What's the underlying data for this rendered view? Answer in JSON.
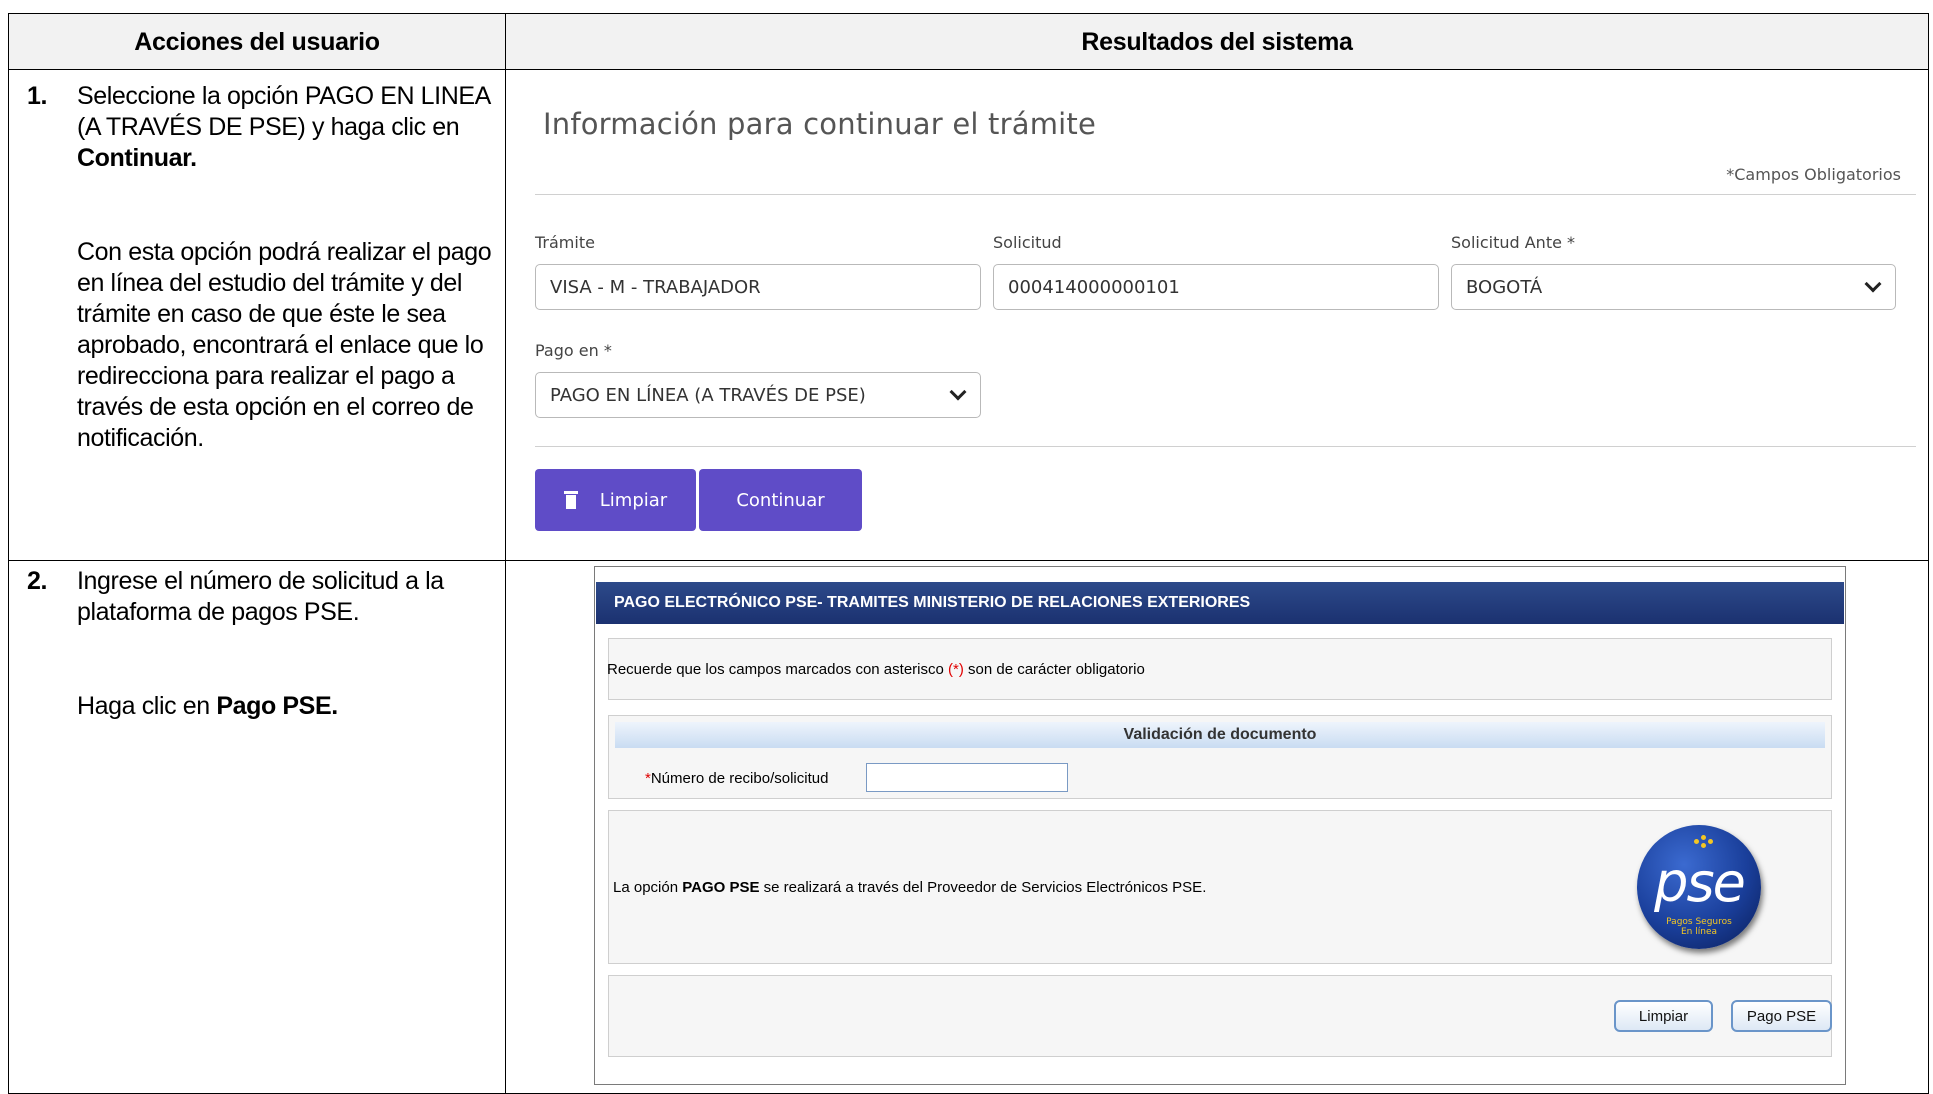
{
  "header": {
    "col1": "Acciones del usuario",
    "col2": "Resultados del sistema"
  },
  "steps": [
    {
      "number": "1.",
      "line1_pre": "Seleccione la opción PAGO EN LINEA (A TRAVÉS DE PSE) y haga clic en ",
      "line1_bold": "Continuar.",
      "paragraph2": "Con esta opción podrá realizar el pago en línea del estudio del trámite y del trámite en caso de que éste le sea aprobado, encontrará el enlace que lo redirecciona para realizar el pago a través de esta opción en el correo de notificación."
    },
    {
      "number": "2.",
      "line1": "Ingrese el número de solicitud a la plataforma de pagos PSE.",
      "line2_pre": "Haga clic en ",
      "line2_bold": "Pago PSE."
    }
  ],
  "form1": {
    "title": "Información para continuar el trámite",
    "required_note": "*Campos Obligatorios",
    "tramite_label": "Trámite",
    "tramite_value": "VISA - M - TRABAJADOR",
    "solicitud_label": "Solicitud",
    "solicitud_value": "000414000000101",
    "solicitud_ante_label": "Solicitud Ante *",
    "solicitud_ante_value": "BOGOTÁ",
    "pago_label": "Pago en *",
    "pago_value": "PAGO EN LÍNEA (A TRAVÉS DE PSE)",
    "btn_limpiar": "Limpiar",
    "btn_continuar": "Continuar",
    "accent_color": "#5f4cc7"
  },
  "pse": {
    "header": "PAGO ELECTRÓNICO PSE- TRAMITES MINISTERIO DE RELACIONES EXTERIORES",
    "note_pre": "Recuerde que los campos marcados con asterisco ",
    "note_mark": "(*)",
    "note_post": " son de carácter obligatorio",
    "validation_title": "Validación de documento",
    "field_asterisk": "*",
    "field_label": "Número de recibo/solicitud",
    "field_value": "",
    "option_pre": "La opción ",
    "option_bold": "PAGO PSE",
    "option_post": " se realizará a través del Proveedor de Servicios Electrónicos PSE.",
    "logo_text": "pse",
    "logo_sub1": "Pagos Seguros",
    "logo_sub2": "En línea",
    "btn_limpiar": "Limpiar",
    "btn_pago": "Pago PSE"
  }
}
